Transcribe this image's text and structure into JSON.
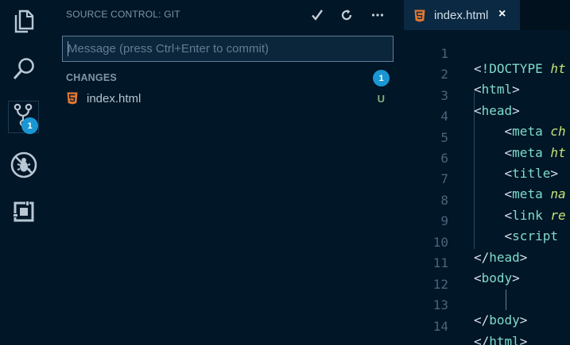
{
  "activity_bar": {
    "items": [
      {
        "name": "explorer",
        "icon": "files-icon"
      },
      {
        "name": "search",
        "icon": "search-icon"
      },
      {
        "name": "source-control",
        "icon": "source-control-icon",
        "badge": "1"
      },
      {
        "name": "debug",
        "icon": "no-bug-icon"
      },
      {
        "name": "extensions",
        "icon": "extensions-icon"
      }
    ]
  },
  "sidebar": {
    "title": "SOURCE CONTROL: GIT",
    "actions": {
      "commit_icon": "check-icon",
      "refresh_icon": "refresh-icon",
      "more_icon": "ellipsis-icon"
    },
    "commit_placeholder": "Message (press Ctrl+Enter to commit)",
    "changes_label": "CHANGES",
    "changes_count": "1",
    "files": [
      {
        "name": "index.html",
        "status": "U",
        "icon": "html5-icon"
      }
    ]
  },
  "editor": {
    "tab": {
      "label": "index.html",
      "close": "×",
      "icon": "html5-icon"
    },
    "lines": [
      {
        "n": "1",
        "text": "<!DOCTYPE ht"
      },
      {
        "n": "2",
        "text": "<html>"
      },
      {
        "n": "3",
        "text": "<head>"
      },
      {
        "n": "4",
        "text": "    <meta ch"
      },
      {
        "n": "5",
        "text": "    <meta ht"
      },
      {
        "n": "6",
        "text": "    <title>"
      },
      {
        "n": "7",
        "text": "    <meta na"
      },
      {
        "n": "8",
        "text": "    <link re"
      },
      {
        "n": "9",
        "text": "    <script "
      },
      {
        "n": "10",
        "text": "</head>"
      },
      {
        "n": "11",
        "text": "<body>"
      },
      {
        "n": "12",
        "text": ""
      },
      {
        "n": "13",
        "text": "</body>"
      },
      {
        "n": "14",
        "text": "</html>"
      }
    ]
  },
  "colors": {
    "background": "#011627",
    "badge": "#1a96d3",
    "tag": "#7fdbca",
    "attr": "#c5e478",
    "bracket": "#d6deeb",
    "line_number": "#4b6479",
    "html5_orange": "#e37933",
    "status_untracked": "#7db37d"
  }
}
